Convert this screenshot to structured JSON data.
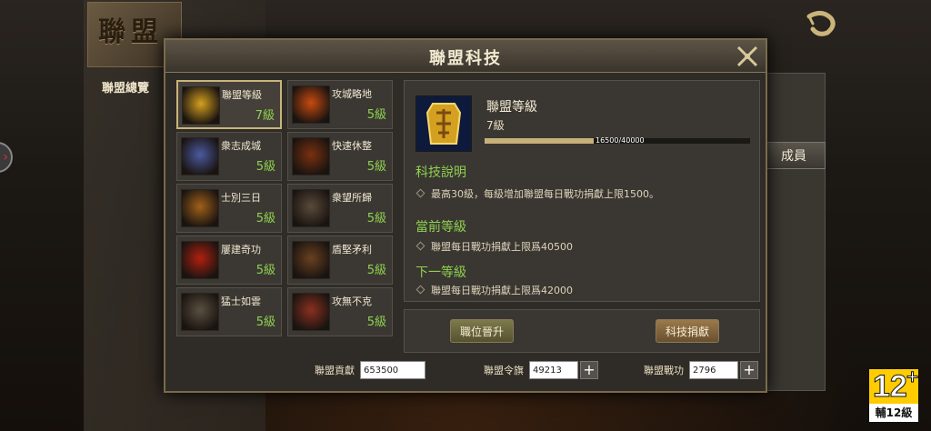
{
  "background": {
    "title": "聯盟",
    "tab_overview": "聯盟總覽",
    "tab_members": "成員"
  },
  "dialog": {
    "title": "聯盟科技"
  },
  "techs": [
    {
      "name": "聯盟等級",
      "level": "7級",
      "icon": "alliance-badge-icon"
    },
    {
      "name": "攻城略地",
      "level": "5級",
      "icon": "siege-fire-icon"
    },
    {
      "name": "衆志成城",
      "level": "5級",
      "icon": "fortress-icon"
    },
    {
      "name": "快速休整",
      "level": "5級",
      "icon": "troops-rest-icon"
    },
    {
      "name": "士別三日",
      "level": "5級",
      "icon": "scroll-book-icon"
    },
    {
      "name": "衆望所歸",
      "level": "5級",
      "icon": "general-icon"
    },
    {
      "name": "屢建奇功",
      "level": "5級",
      "icon": "war-banner-icon"
    },
    {
      "name": "盾堅矛利",
      "level": "5級",
      "icon": "shield-spear-icon"
    },
    {
      "name": "猛士如雲",
      "level": "5級",
      "icon": "warriors-icon"
    },
    {
      "name": "攻無不克",
      "level": "5級",
      "icon": "attack-soldier-icon"
    }
  ],
  "detail": {
    "name": "聯盟等級",
    "level": "7級",
    "progress_text": "16500/40000",
    "progress_fraction": 0.4125,
    "desc_head": "科技說明",
    "desc_line": "最高30級，每級增加聯盟每日戰功捐獻上限1500。",
    "current_head": "當前等級",
    "current_line": "聯盟每日戰功捐獻上限爲40500",
    "next_head": "下一等級",
    "next_line": "聯盟每日戰功捐獻上限爲42000"
  },
  "actions": {
    "promote_label": "職位晉升",
    "donate_label": "科技捐獻"
  },
  "resources": [
    {
      "label": "聯盟貢獻",
      "value": "653500"
    },
    {
      "label": "聯盟令旗",
      "value": "49213"
    },
    {
      "label": "聯盟戰功",
      "value": "2796"
    }
  ],
  "rating": {
    "age": "12",
    "plus": "+",
    "text": "輔12級"
  },
  "colors": {
    "level_green": "#8fd14f",
    "panel": "#3a3732",
    "gold_border": "#c9b57a"
  }
}
